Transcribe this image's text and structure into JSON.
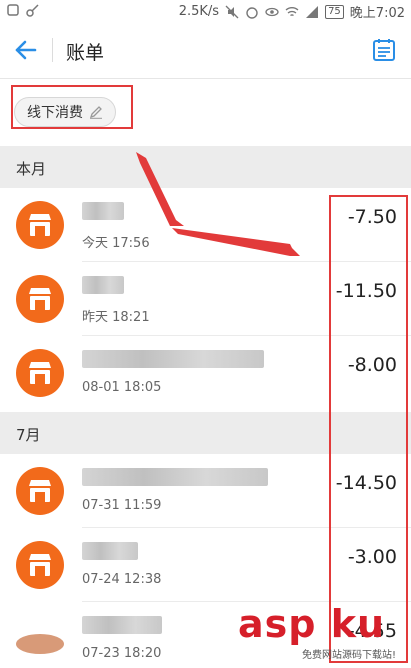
{
  "status_bar": {
    "speed": "2.5K/s",
    "battery": "75",
    "time": "晚上7:02"
  },
  "app_bar": {
    "title": "账单",
    "back_icon": "arrow-left-icon",
    "right_icon": "bill-list-icon"
  },
  "filter": {
    "chip_label": "线下消费",
    "chip_icon": "pencil-icon"
  },
  "sections": [
    {
      "title": "本月",
      "items": [
        {
          "time": "今天 17:56",
          "amount": "-7.50"
        },
        {
          "time": "昨天 18:21",
          "amount": "-11.50"
        },
        {
          "time": "08-01 18:05",
          "amount": "-8.00"
        }
      ]
    },
    {
      "title": "7月",
      "items": [
        {
          "time": "07-31 11:59",
          "amount": "-14.50"
        },
        {
          "time": "07-24 12:38",
          "amount": "-3.00"
        },
        {
          "time": "07-23 18:20",
          "amount": "-4.55"
        }
      ]
    }
  ],
  "watermark": {
    "logo_text": "asp ku",
    "sub_text": "免费网站源码下载站!"
  },
  "colors": {
    "accent": "#2a8ee6",
    "store_orange": "#f26a1b",
    "highlight_red": "#e23a3a"
  }
}
